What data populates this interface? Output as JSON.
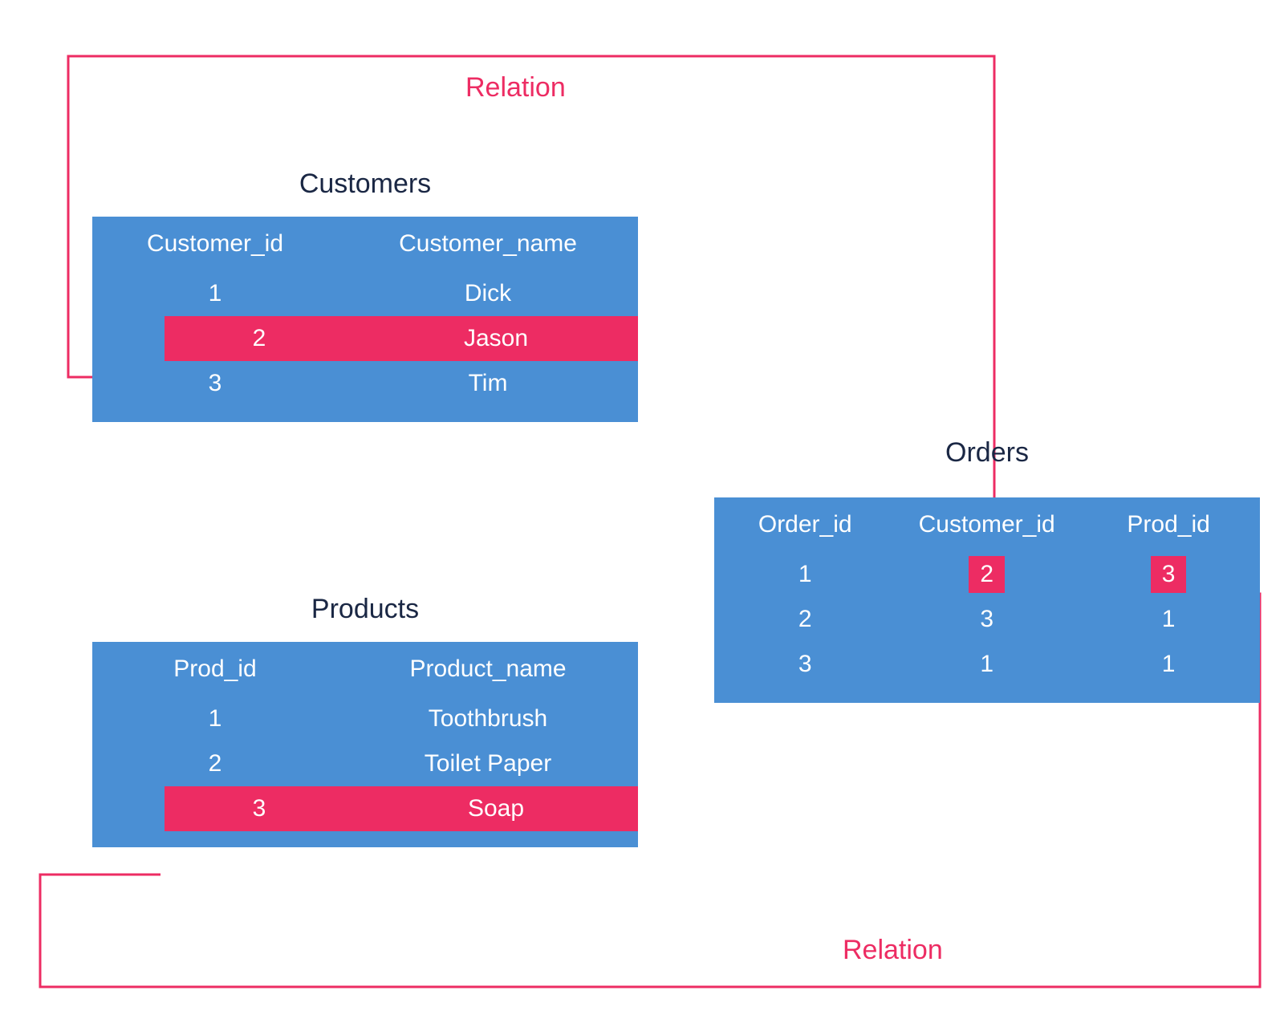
{
  "labels": {
    "relation_top": "Relation",
    "relation_bottom": "Relation"
  },
  "customers": {
    "title": "Customers",
    "columns": [
      "Customer_id",
      "Customer_name"
    ],
    "rows": [
      {
        "id": "1",
        "name": "Dick"
      },
      {
        "id": "2",
        "name": "Jason"
      },
      {
        "id": "3",
        "name": "Tim"
      }
    ],
    "highlight_index": 1
  },
  "products": {
    "title": "Products",
    "columns": [
      "Prod_id",
      "Product_name"
    ],
    "rows": [
      {
        "id": "1",
        "name": "Toothbrush"
      },
      {
        "id": "2",
        "name": "Toilet Paper"
      },
      {
        "id": "3",
        "name": "Soap"
      }
    ],
    "highlight_index": 2
  },
  "orders": {
    "title": "Orders",
    "columns": [
      "Order_id",
      "Customer_id",
      "Prod_id"
    ],
    "rows": [
      {
        "order_id": "1",
        "customer_id": "2",
        "prod_id": "3"
      },
      {
        "order_id": "2",
        "customer_id": "3",
        "prod_id": "1"
      },
      {
        "order_id": "3",
        "customer_id": "1",
        "prod_id": "1"
      }
    ],
    "highlight_row_index": 0
  },
  "colors": {
    "table_bg": "#4a8fd4",
    "highlight": "#ed2c63",
    "text_dark": "#1a2744"
  }
}
